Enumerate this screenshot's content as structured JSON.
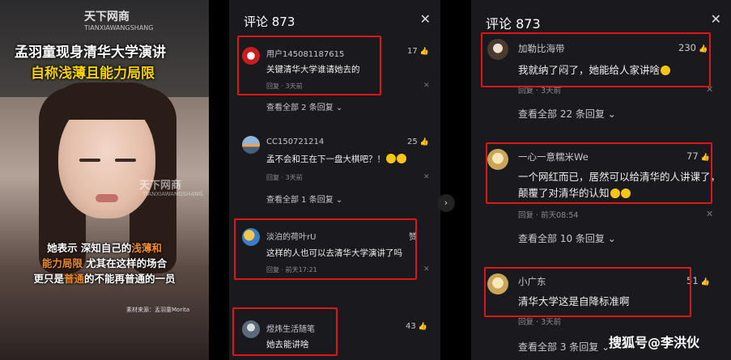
{
  "video": {
    "logo": "天下网商",
    "logo_sub": "TIANXIAWANGSHANG",
    "watermark": "天下网商",
    "title_line1": "孟羽童现身清华大学演讲",
    "title_line2": "自称浅薄且能力局限",
    "sub_line1_a": "她表示 深知自己的",
    "sub_line1_b": "浅薄和",
    "sub_line2_a": "能力局限",
    "sub_line2_b": " 尤其在这样的场合",
    "sub_line3_a": "更只是",
    "sub_line3_b": "普通",
    "sub_line3_c": "的不能再普通的一员",
    "source": "素材来源：孟羽童Morita"
  },
  "mid": {
    "header": "评论 873",
    "close": "✕",
    "more_label_1": "查看全部 2 条回复",
    "more_label_2": "查看全部 1 条回复",
    "comments": [
      {
        "user": "用户145081187615",
        "text": "关键清华大学谁请她去的",
        "reply": "回复",
        "time": "3天前",
        "likes": "17"
      },
      {
        "user": "CC150721214",
        "text": "孟不会和王在下一盘大棋吧？！",
        "reply": "回复",
        "time": "3天前",
        "likes": "25"
      },
      {
        "user": "淡泊的荷叶rU",
        "text": "这样的人也可以去清华大学演讲了吗",
        "reply": "回复",
        "time": "前天17:21",
        "likes": "赞"
      },
      {
        "user": "煜炜生活随笔",
        "text": "她去能讲啥",
        "likes": "43"
      }
    ]
  },
  "right": {
    "header": "评论 873",
    "close": "✕",
    "more_label_1": "查看全部 22 条回复",
    "more_label_2": "查看全部 10 条回复",
    "more_label_3": "查看全部 3 条回复",
    "comments": [
      {
        "user": "加勒比海带",
        "text": "我就纳了闷了，她能给人家讲啥",
        "reply": "回复",
        "time": "3天前",
        "likes": "230"
      },
      {
        "user": "一心一意糯米We",
        "text": "一个网红而已，居然可以给清华的人讲课了，",
        "text2": "颠覆了对清华的认知",
        "reply": "回复",
        "time": "前天08:54",
        "likes": "77"
      },
      {
        "user": "小广东",
        "text": "清华大学这是自降标准啊",
        "reply": "回复",
        "time": "3天前",
        "likes": "51"
      }
    ]
  },
  "footer": {
    "sohu": "搜狐号@李洪伙"
  },
  "colors": {
    "highlight_box": "#e01616",
    "panel_bg": "#1a1a1e",
    "title_yellow": "#f5d100",
    "accent_orange": "#f08b2c"
  }
}
